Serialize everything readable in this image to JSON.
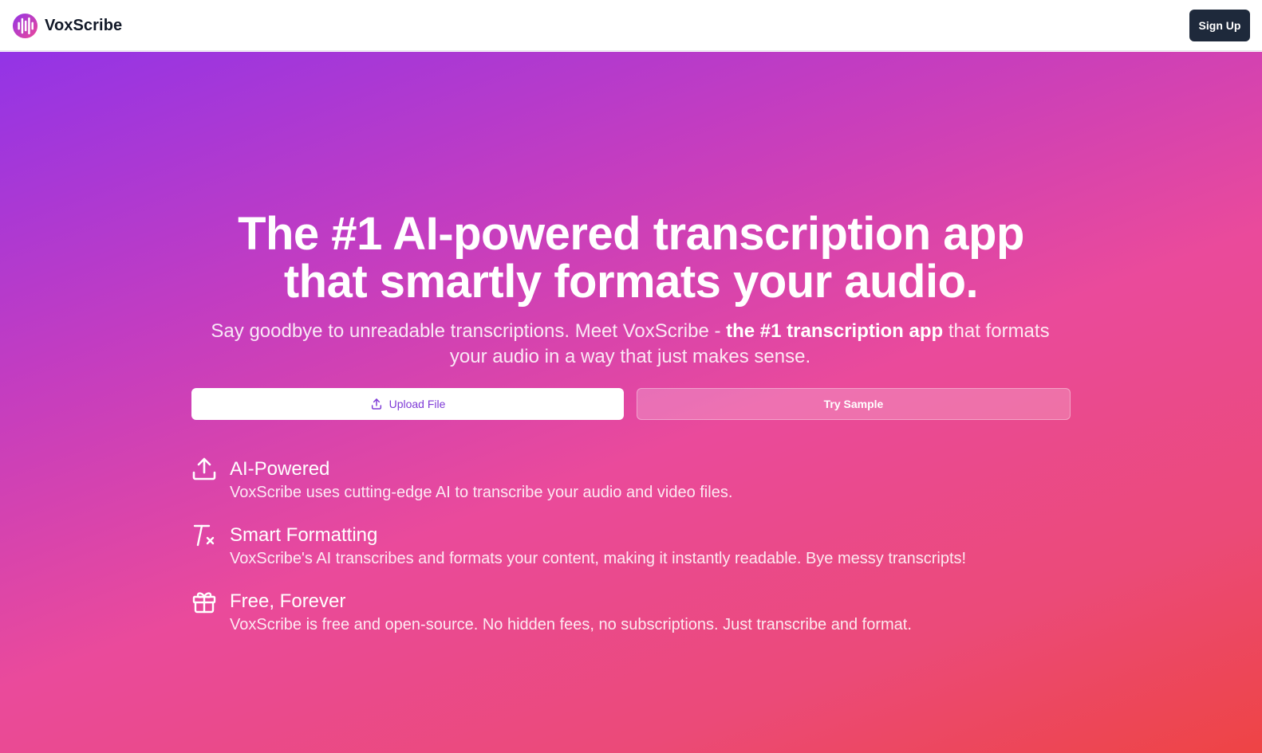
{
  "brand": {
    "name": "VoxScribe"
  },
  "nav": {
    "signup_label": "Sign Up"
  },
  "hero": {
    "headline_line1": "The #1 AI-powered transcription app",
    "headline_line2": "that smartly formats your audio.",
    "subtitle_part1": "Say goodbye to unreadable transcriptions. Meet VoxScribe - ",
    "subtitle_bold": "the #1 transcription app",
    "subtitle_part2": " that formats your audio in a way that just makes sense.",
    "upload_label": "Upload File",
    "sample_label": "Try Sample"
  },
  "features": [
    {
      "icon": "upload-icon",
      "title": "AI-Powered",
      "description": "VoxScribe uses cutting-edge AI to transcribe your audio and video files."
    },
    {
      "icon": "remove-formatting-icon",
      "title": "Smart Formatting",
      "description": "VoxScribe's AI transcribes and formats your content, making it instantly readable. Bye messy transcripts!"
    },
    {
      "icon": "gift-icon",
      "title": "Free, Forever",
      "description": "VoxScribe is free and open-source. No hidden fees, no subscriptions. Just transcribe and format."
    }
  ],
  "colors": {
    "gradient_start": "#9334e6",
    "gradient_mid": "#ea4a9b",
    "gradient_end": "#ee4444",
    "signup_bg": "#1e293b",
    "upload_text": "#7e3ad6"
  }
}
